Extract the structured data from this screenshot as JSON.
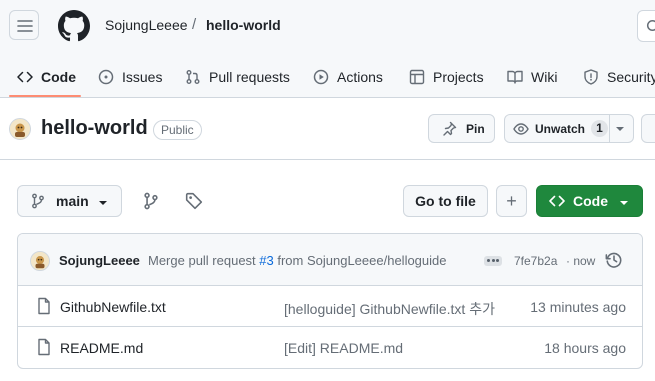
{
  "header": {
    "owner": "SojungLeeee",
    "separator": "/",
    "repo": "hello-world"
  },
  "nav": {
    "tabs": [
      {
        "label": "Code",
        "icon": "code-icon",
        "active": true
      },
      {
        "label": "Issues",
        "icon": "issue-icon"
      },
      {
        "label": "Pull requests",
        "icon": "pull-request-icon"
      },
      {
        "label": "Actions",
        "icon": "play-icon"
      },
      {
        "label": "Projects",
        "icon": "table-icon"
      },
      {
        "label": "Wiki",
        "icon": "book-icon"
      },
      {
        "label": "Security",
        "icon": "shield-icon"
      }
    ]
  },
  "repo": {
    "title": "hello-world",
    "visibility": "Public",
    "pin_label": "Pin",
    "watch_label": "Unwatch",
    "watch_count": "1"
  },
  "toolbar": {
    "branch": "main",
    "go_to_file": "Go to file",
    "add": "+",
    "code": "Code"
  },
  "latest_commit": {
    "author": "SojungLeeee",
    "message_prefix": "Merge pull request ",
    "pr_link": "#3",
    "message_suffix": " from SojungLeeee/helloguide",
    "sha": "7fe7b2a",
    "when": "· now"
  },
  "files": [
    {
      "name": "GithubNewfile.txt",
      "commit": "[helloguide] GithubNewfile.txt 추가",
      "time": "13 minutes ago"
    },
    {
      "name": "README.md",
      "commit": "[Edit] README.md",
      "time": "18 hours ago"
    }
  ],
  "colors": {
    "accent": "#fd8c73",
    "primary_button": "#1f883d",
    "link": "#0969da"
  }
}
